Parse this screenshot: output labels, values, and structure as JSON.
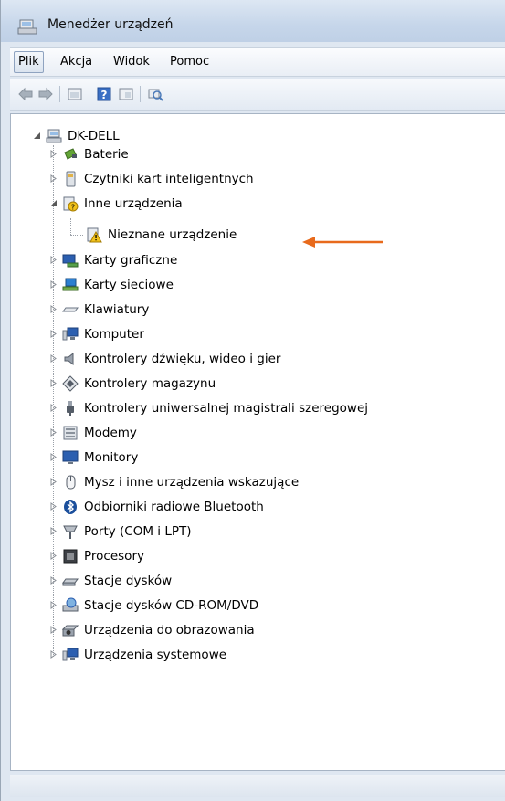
{
  "window": {
    "title": "Menedżer urządzeń"
  },
  "menu": [
    {
      "label": "Plik",
      "selected": true
    },
    {
      "label": "Akcja",
      "selected": false
    },
    {
      "label": "Widok",
      "selected": false
    },
    {
      "label": "Pomoc",
      "selected": false
    }
  ],
  "toolbar": {
    "icons": [
      "back-arrow-icon",
      "forward-arrow-icon",
      "properties-icon",
      "help-icon",
      "view-icon",
      "scan-hardware-icon"
    ]
  },
  "tree": {
    "root": {
      "label": "DK-DELL",
      "icon": "computer-icon"
    },
    "items": [
      {
        "label": "Baterie",
        "icon": "battery-icon",
        "level": 1,
        "state": "collapsed"
      },
      {
        "label": "Czytniki kart inteligentnych",
        "icon": "smartcard-reader-icon",
        "level": 1,
        "state": "collapsed"
      },
      {
        "label": "Inne urządzenia",
        "icon": "unknown-device-icon",
        "level": 1,
        "state": "expanded"
      },
      {
        "label": "Nieznane urządzenie",
        "icon": "warning-device-icon",
        "level": 2,
        "state": "leaf"
      },
      {
        "label": "Karty graficzne",
        "icon": "display-adapter-icon",
        "level": 1,
        "state": "collapsed"
      },
      {
        "label": "Karty sieciowe",
        "icon": "network-adapter-icon",
        "level": 1,
        "state": "collapsed"
      },
      {
        "label": "Klawiatury",
        "icon": "keyboard-icon",
        "level": 1,
        "state": "collapsed"
      },
      {
        "label": "Komputer",
        "icon": "computer-monitor-icon",
        "level": 1,
        "state": "collapsed"
      },
      {
        "label": "Kontrolery dźwięku, wideo i gier",
        "icon": "speaker-icon",
        "level": 1,
        "state": "collapsed"
      },
      {
        "label": "Kontrolery magazynu",
        "icon": "storage-controller-icon",
        "level": 1,
        "state": "collapsed"
      },
      {
        "label": "Kontrolery uniwersalnej magistrali szeregowej",
        "icon": "usb-icon",
        "level": 1,
        "state": "collapsed"
      },
      {
        "label": "Modemy",
        "icon": "modem-icon",
        "level": 1,
        "state": "collapsed"
      },
      {
        "label": "Monitory",
        "icon": "monitor-icon",
        "level": 1,
        "state": "collapsed"
      },
      {
        "label": "Mysz i inne urządzenia wskazujące",
        "icon": "mouse-icon",
        "level": 1,
        "state": "collapsed"
      },
      {
        "label": "Odbiorniki radiowe Bluetooth",
        "icon": "bluetooth-icon",
        "level": 1,
        "state": "collapsed"
      },
      {
        "label": "Porty (COM i LPT)",
        "icon": "port-icon",
        "level": 1,
        "state": "collapsed"
      },
      {
        "label": "Procesory",
        "icon": "processor-icon",
        "level": 1,
        "state": "collapsed"
      },
      {
        "label": "Stacje dysków",
        "icon": "disk-drive-icon",
        "level": 1,
        "state": "collapsed"
      },
      {
        "label": "Stacje dysków CD-ROM/DVD",
        "icon": "cdrom-icon",
        "level": 1,
        "state": "collapsed"
      },
      {
        "label": "Urządzenia do obrazowania",
        "icon": "camera-icon",
        "level": 1,
        "state": "collapsed"
      },
      {
        "label": "Urządzenia systemowe",
        "icon": "system-device-icon",
        "level": 1,
        "state": "collapsed"
      }
    ]
  },
  "colors": {
    "annotation_arrow": "#e86a1c",
    "warning": "#f2c21a"
  }
}
